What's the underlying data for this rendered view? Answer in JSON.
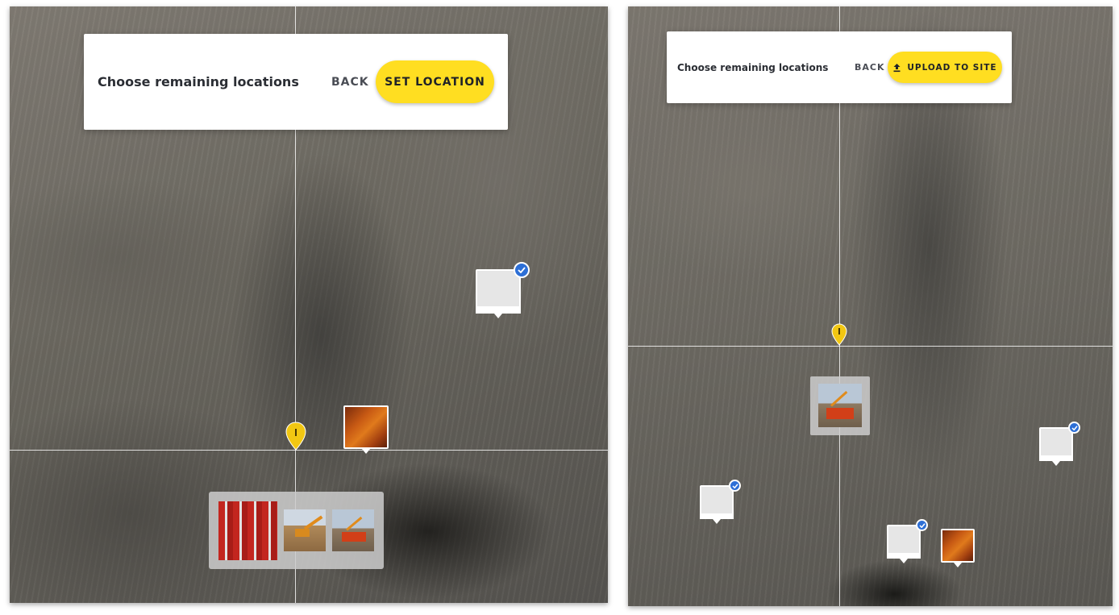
{
  "left_screen": {
    "panel": {
      "title": "Choose remaining locations",
      "back_label": "BACK",
      "primary_label": "SET LOCATION"
    },
    "markers": [
      {
        "type": "placeholder",
        "checked": true
      },
      {
        "type": "photo",
        "photo": "orange-closeup"
      }
    ],
    "tray": {
      "thumbnails": [
        "red-equipment-photo",
        "excavator-photo",
        "truck-photo"
      ]
    },
    "pin_icon": "map-pin-icon"
  },
  "right_screen": {
    "panel": {
      "title": "Choose remaining locations",
      "back_label": "BACK",
      "primary_label": "UPLOAD TO SITE",
      "primary_icon": "upload-icon"
    },
    "markers": [
      {
        "type": "photo-selected",
        "photo": "truck-photo"
      },
      {
        "type": "placeholder",
        "checked": true
      },
      {
        "type": "placeholder",
        "checked": true
      },
      {
        "type": "placeholder",
        "checked": true
      },
      {
        "type": "photo",
        "photo": "orange-closeup"
      }
    ],
    "pin_icon": "map-pin-icon"
  },
  "colors": {
    "accent_yellow": "#ffde21",
    "check_blue": "#2d6fd6",
    "crosshair": "#ffffff"
  }
}
